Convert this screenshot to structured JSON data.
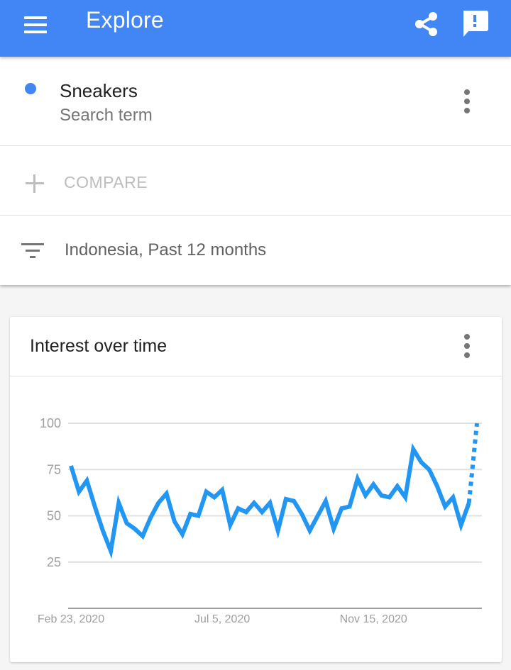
{
  "appbar": {
    "title": "Explore",
    "menu_icon": "hamburger-menu-icon",
    "share_icon": "share-icon",
    "feedback_icon": "feedback-icon",
    "color": "#4285f4"
  },
  "search_term": {
    "name": "Sneakers",
    "type": "Search term",
    "color": "#4285f4"
  },
  "compare": {
    "label": "COMPARE"
  },
  "filter": {
    "label": "Indonesia, Past 12 months"
  },
  "chart_card": {
    "title": "Interest over time"
  },
  "chart_data": {
    "type": "line",
    "title": "Interest over time",
    "xlabel": "",
    "ylabel": "",
    "ylim": [
      0,
      100
    ],
    "yticks": [
      25,
      50,
      75,
      100
    ],
    "xtick_labels": [
      "Feb 23, 2020",
      "Jul 5, 2020",
      "Nov 15, 2020"
    ],
    "xtick_indices": [
      0,
      19,
      38
    ],
    "grid": true,
    "line_color": "#2196f3",
    "series": [
      {
        "name": "Sneakers",
        "partial_from_index": 50,
        "values": [
          77,
          63,
          69,
          55,
          42,
          31,
          57,
          46,
          43,
          39,
          49,
          57,
          62,
          47,
          40,
          51,
          50,
          63,
          60,
          64,
          45,
          54,
          52,
          57,
          52,
          57,
          42,
          59,
          58,
          51,
          42,
          50,
          58,
          43,
          54,
          55,
          70,
          61,
          67,
          61,
          60,
          66,
          60,
          86,
          79,
          75,
          66,
          55,
          60,
          45,
          57,
          100
        ]
      }
    ]
  }
}
